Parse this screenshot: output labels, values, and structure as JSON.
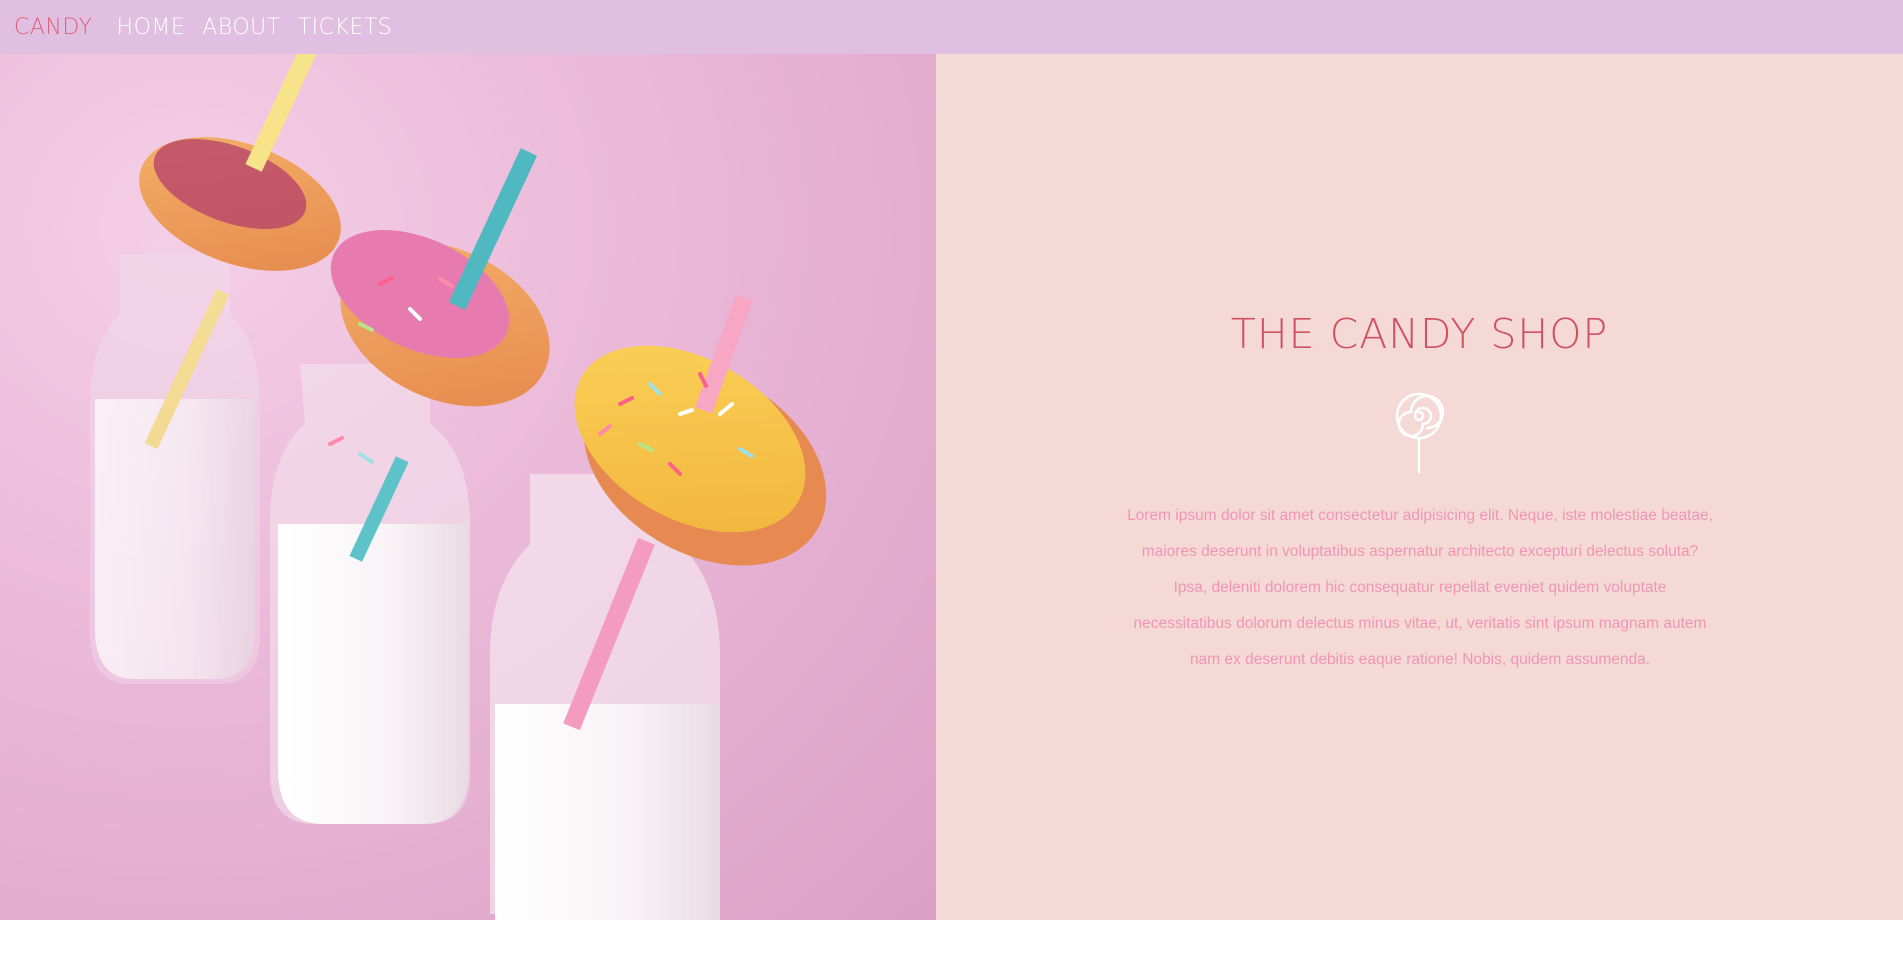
{
  "nav": {
    "brand": "CANDY",
    "links": [
      "HOME",
      "ABOUT",
      "TICKETS"
    ]
  },
  "hero": {
    "title": "THE CANDY SHOP",
    "icon": "lollipop-icon",
    "body": "Lorem ipsum dolor sit amet consectetur adipisicing elit. Neque, iste molestiae beatae, maiores deserunt in voluptatibus aspernatur architecto excepturi delectus soluta? Ipsa, deleniti dolorem hic consequatur repellat eveniet quidem voluptate necessitatibus dolorum delectus minus vitae, ut, veritatis sint ipsum magnam autem nam ex deserunt debitis eaque ratione! Nobis, quidem assumenda."
  },
  "colors": {
    "navbar": "#e0bfe0",
    "brand": "#e0607a",
    "panel": "#f5d9d6",
    "title": "#d05064",
    "body_text": "#ef96b4"
  }
}
